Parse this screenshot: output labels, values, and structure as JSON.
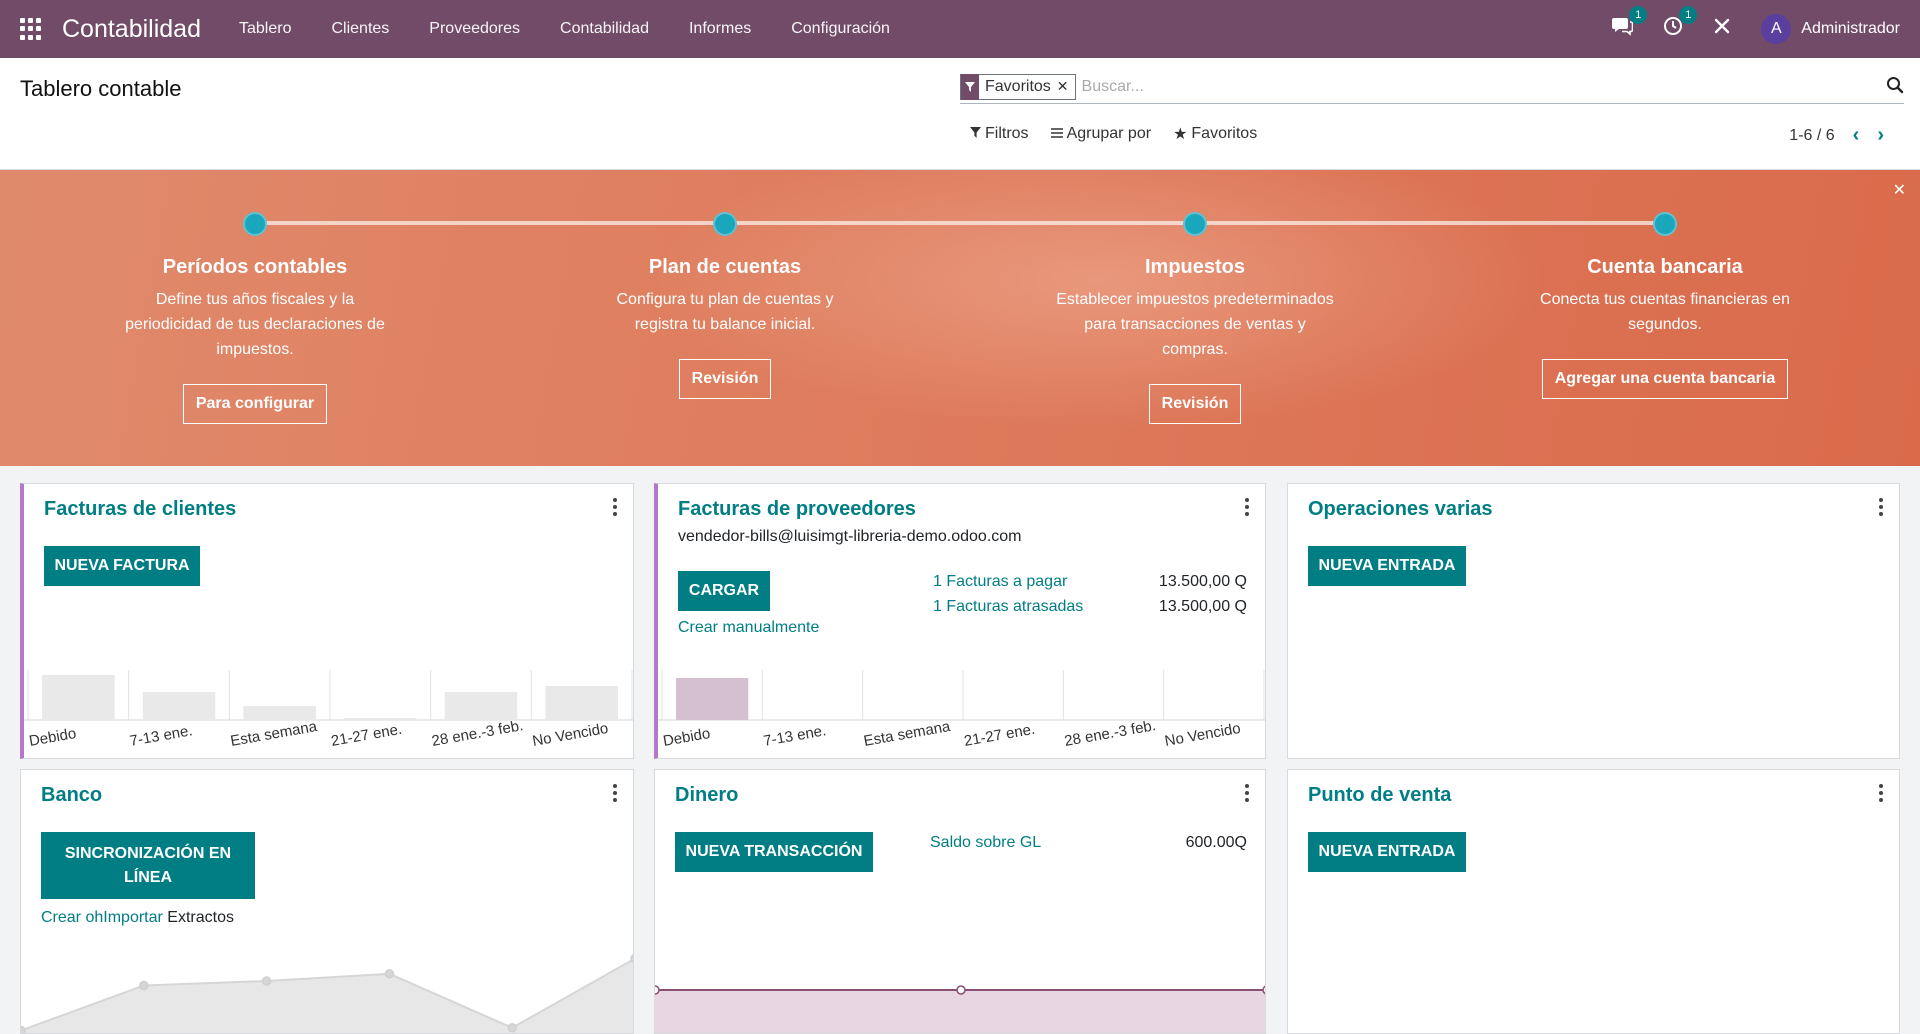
{
  "navbar": {
    "brand": "Contabilidad",
    "menu": [
      "Tablero",
      "Clientes",
      "Proveedores",
      "Contabilidad",
      "Informes",
      "Configuración"
    ],
    "messages_badge": "1",
    "activity_badge": "1",
    "user_initial": "A",
    "user_name": "Administrador",
    "color": "#714b67"
  },
  "control_panel": {
    "title": "Tablero contable",
    "search": {
      "facet": "Favoritos",
      "placeholder": "Buscar..."
    },
    "filters_label": "Filtros",
    "group_by_label": "Agrupar por",
    "favorites_label": "Favoritos",
    "pager": "1-6 / 6"
  },
  "onboarding": {
    "steps": [
      {
        "title": "Períodos contables",
        "desc": "Define tus años fiscales y la periodicidad de tus declaraciones de impuestos.",
        "button": "Para configurar"
      },
      {
        "title": "Plan de cuentas",
        "desc": "Configura tu plan de cuentas y registra tu balance inicial.",
        "button": "Revisión"
      },
      {
        "title": "Impuestos",
        "desc": "Establecer impuestos predeterminados para transacciones de ventas y compras.",
        "button": "Revisión"
      },
      {
        "title": "Cuenta bancaria",
        "desc": "Conecta tus cuentas financieras en segundos.",
        "button": "Agregar una cuenta bancaria"
      }
    ],
    "close_icon": "close-icon"
  },
  "cards": {
    "customer_invoices": {
      "title": "Facturas de clientes",
      "button": "NUEVA FACTURA"
    },
    "vendor_bills": {
      "title": "Facturas de proveedores",
      "email": "vendedor-bills@luisimgt-libreria-demo.odoo.com",
      "button": "CARGAR",
      "manual_link": "Crear manualmente",
      "stats": [
        {
          "label": "1 Facturas a pagar",
          "value": "13.500,00 Q"
        },
        {
          "label": "1 Facturas atrasadas",
          "value": "13.500,00 Q"
        }
      ]
    },
    "misc_operations": {
      "title": "Operaciones varias",
      "button": "NUEVA ENTRADA"
    },
    "bank": {
      "title": "Banco",
      "button_line1": "SINCRONIZACIÓN EN",
      "button_line2": "LÍNEA",
      "create_link": "Crear",
      "oh_text": "oh",
      "import_link": "Importar",
      "statements_text": "Extractos"
    },
    "cash": {
      "title": "Dinero",
      "button": "NUEVA TRANSACCIÓN",
      "gl_label": "Saldo sobre GL",
      "gl_value": "600.00Q"
    },
    "pos": {
      "title": "Punto de venta",
      "button": "NUEVA ENTRADA"
    }
  },
  "chart_data": [
    {
      "type": "bar",
      "chart": "customer_invoices",
      "categories": [
        "Debido",
        "7-13 ene.",
        "Esta semana",
        "21-27 ene.",
        "28 ene.-3 feb.",
        "No Vencido"
      ],
      "values": [
        45,
        28,
        14,
        2,
        28,
        34
      ],
      "ylim": [
        0,
        50
      ],
      "color": "#e9e9ea"
    },
    {
      "type": "bar",
      "chart": "vendor_bills",
      "categories": [
        "Debido",
        "7-13 ene.",
        "Esta semana",
        "21-27 ene.",
        "28 ene.-3 feb.",
        "No Vencido"
      ],
      "values": [
        42,
        0,
        0,
        0,
        0,
        0
      ],
      "ylim": [
        0,
        50
      ],
      "color": "#d4c0cf"
    },
    {
      "type": "area",
      "chart": "bank",
      "values": [
        5,
        55,
        60,
        68,
        8,
        85
      ],
      "ylim": [
        0,
        100
      ],
      "color": "#e7e7e8"
    },
    {
      "type": "area",
      "chart": "cash",
      "values": [
        50,
        50,
        50
      ],
      "ylim": [
        0,
        100
      ],
      "color": "#e8d6e2"
    }
  ]
}
